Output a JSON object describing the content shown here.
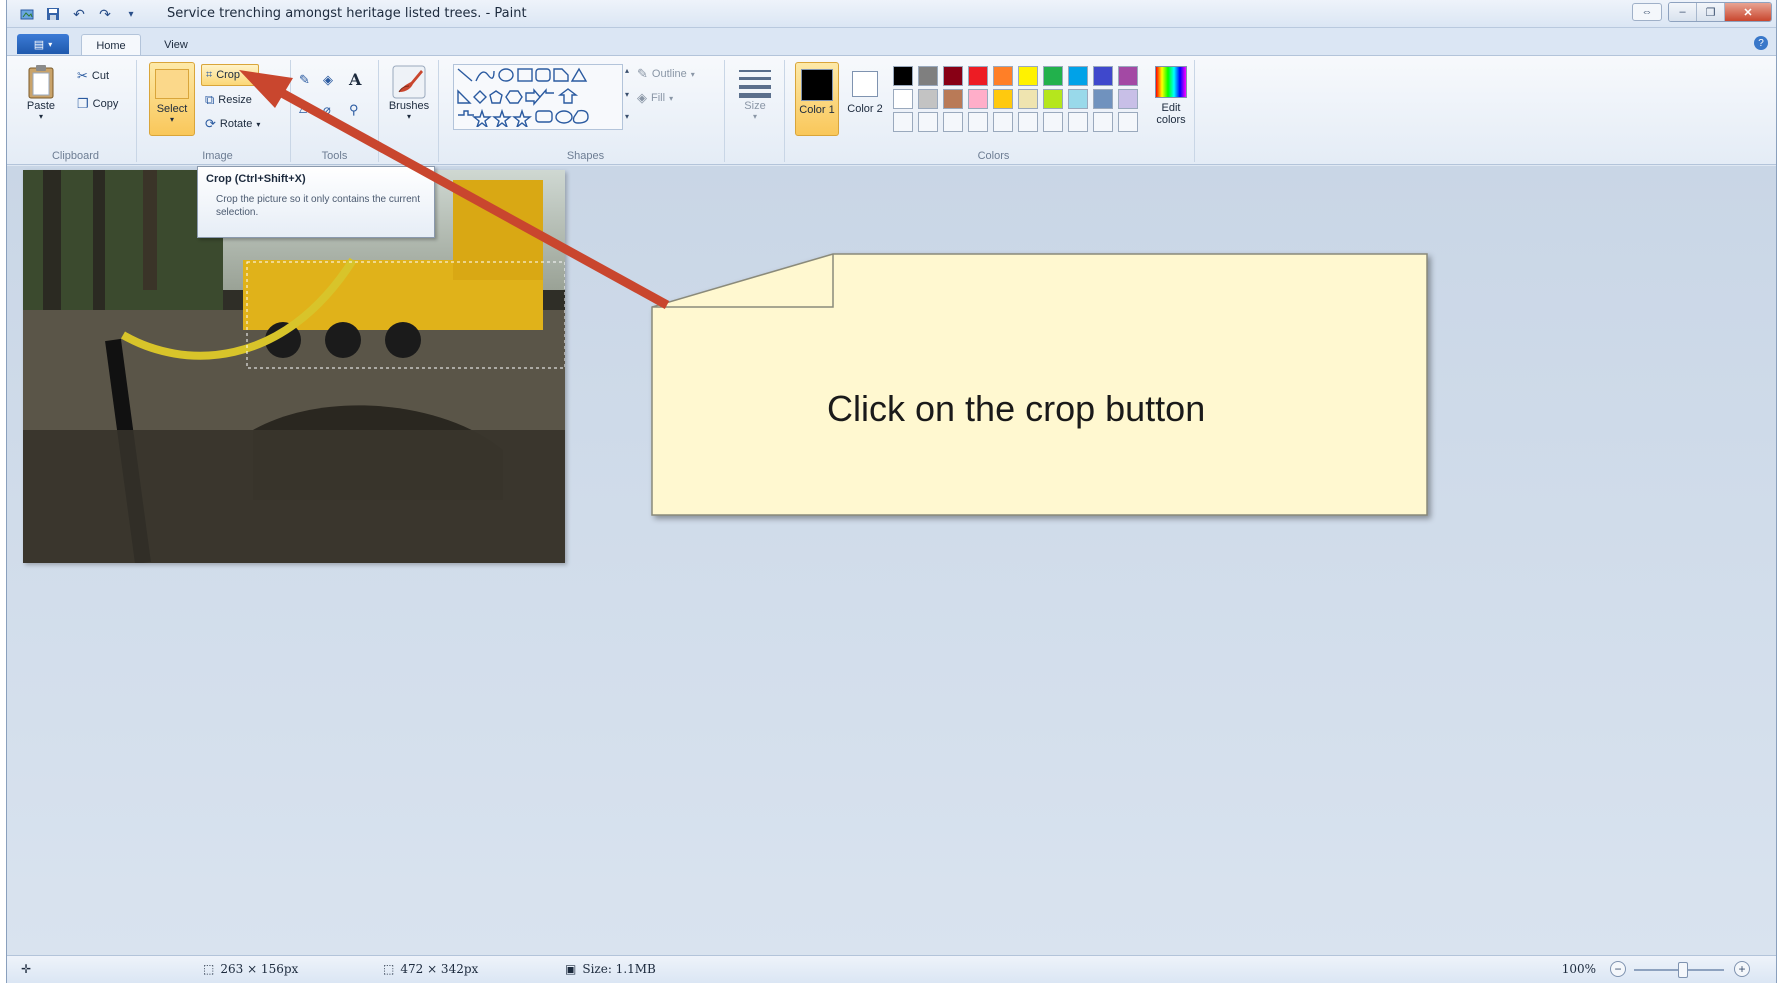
{
  "window": {
    "title": "Service trenching amongst heritage listed trees. - Paint"
  },
  "tabs": {
    "home": "Home",
    "view": "View"
  },
  "clipboard": {
    "paste": "Paste",
    "cut": "Cut",
    "copy": "Copy",
    "label": "Clipboard"
  },
  "image": {
    "select": "Select",
    "crop": "Crop",
    "resize": "Resize",
    "rotate": "Rotate",
    "label": "Image"
  },
  "tools": {
    "label": "Tools"
  },
  "brushes": {
    "label": "Brushes"
  },
  "shapes": {
    "outline": "Outline",
    "fill": "Fill",
    "label": "Shapes"
  },
  "size": {
    "label": "Size"
  },
  "colors": {
    "color1": "Color 1",
    "color2": "Color 2",
    "edit": "Edit colors",
    "label": "Colors",
    "row1": [
      "#000000",
      "#7f7f7f",
      "#880015",
      "#ed1c24",
      "#ff7f27",
      "#fff200",
      "#22b14c",
      "#00a2e8",
      "#3f48cc",
      "#a349a4"
    ],
    "row2": [
      "#ffffff",
      "#c3c3c3",
      "#b97a57",
      "#ffaec9",
      "#ffc90e",
      "#efe4b0",
      "#b5e61d",
      "#99d9ea",
      "#7092be",
      "#c8bfe7"
    ]
  },
  "tooltip": {
    "title": "Crop (Ctrl+Shift+X)",
    "body": "Crop the picture so it only contains the current selection."
  },
  "callout": {
    "text": "Click on the crop button"
  },
  "status": {
    "selection": "263 × 156px",
    "image_size": "472 × 342px",
    "file_size": "Size: 1.1MB",
    "zoom": "100%"
  }
}
